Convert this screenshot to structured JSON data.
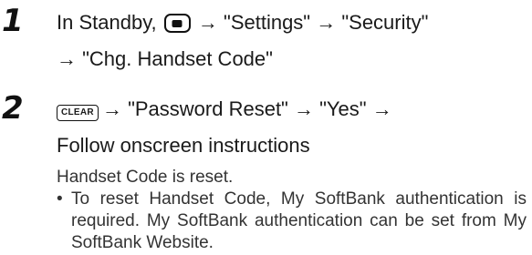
{
  "step1": {
    "number": "1",
    "line1_prefix": "In Standby, ",
    "menu_key_icon": "menu-key-icon",
    "line1_suffix": " → \"Settings\" → \"Security\"",
    "line2": "→ \"Chg. Handset Code\""
  },
  "step2": {
    "number": "2",
    "clear_key": "CLEAR",
    "line1_suffix": "→ \"Password Reset\" → \"Yes\" →",
    "line2": "Follow onscreen instructions",
    "result": "Handset Code is reset.",
    "bullet_mark": "•",
    "note": "To reset Handset Code, My SoftBank authentication is required. My SoftBank authentication can be set from My SoftBank Website."
  }
}
